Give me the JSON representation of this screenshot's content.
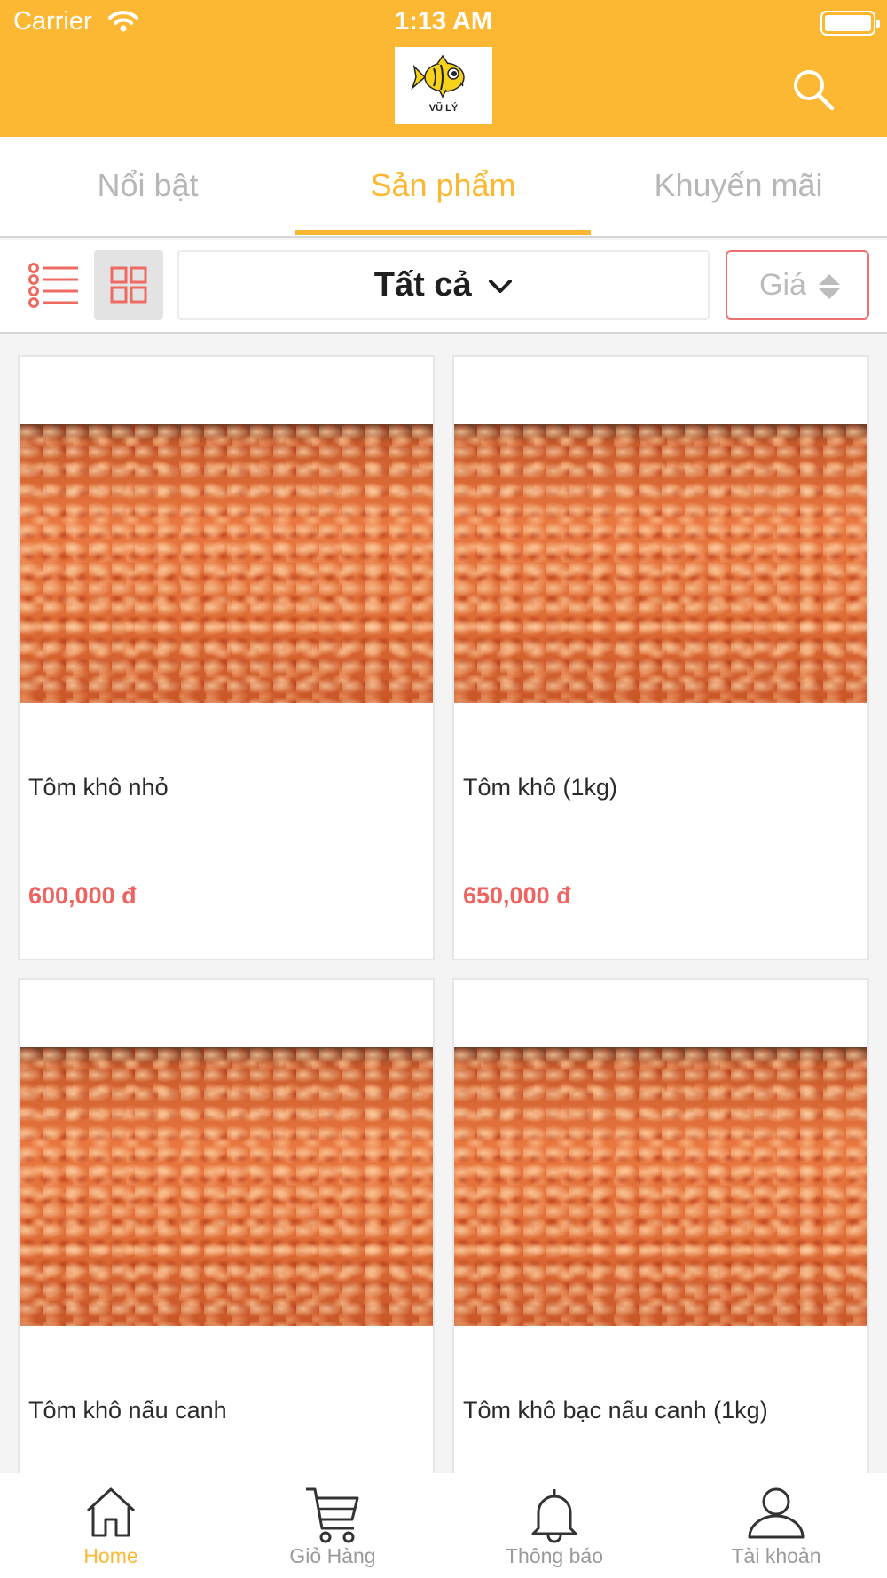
{
  "status_bar": {
    "carrier": "Carrier",
    "time": "1:13 AM"
  },
  "header": {
    "logo_text": "VŨ LÝ",
    "logo_icon": "fish-logo",
    "search_icon": "search-icon"
  },
  "tabs": [
    {
      "label": "Nổi bật",
      "active": false
    },
    {
      "label": "Sản phẩm",
      "active": true
    },
    {
      "label": "Khuyến mãi",
      "active": false
    }
  ],
  "toolbar": {
    "view_mode": "grid",
    "category_label": "Tất cả",
    "sort_label": "Giá"
  },
  "products": [
    {
      "name": "Tôm khô nhỏ",
      "price": "600,000 đ"
    },
    {
      "name": "Tôm khô (1kg)",
      "price": "650,000 đ"
    },
    {
      "name": "Tôm khô nấu canh",
      "price": ""
    },
    {
      "name": "Tôm khô bạc nấu canh (1kg)",
      "price": ""
    }
  ],
  "bottom_nav": [
    {
      "label": "Home",
      "icon": "home-icon",
      "active": true
    },
    {
      "label": "Giỏ Hàng",
      "icon": "cart-icon",
      "active": false
    },
    {
      "label": "Thông báo",
      "icon": "bell-icon",
      "active": false
    },
    {
      "label": "Tài khoản",
      "icon": "user-icon",
      "active": false
    }
  ],
  "colors": {
    "accent": "#fdb833",
    "price": "#ef6461",
    "sort_border": "#ef7070",
    "inactive": "#b7b7b7"
  }
}
